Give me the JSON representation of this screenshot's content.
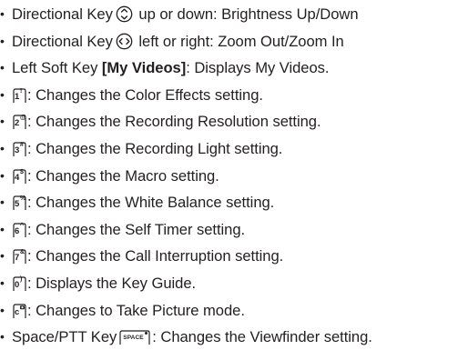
{
  "bullet": "•",
  "items": [
    {
      "pre": "Directional Key",
      "key_type": "dir-ud",
      "key_icon": "up-down-directional-key-icon",
      "post": " up or down: Brightness Up/Down"
    },
    {
      "pre": "Directional Key",
      "key_type": "dir-lr",
      "key_icon": "left-right-directional-key-icon",
      "post": " left or right: Zoom Out/Zoom In"
    },
    {
      "pre": "Left Soft Key ",
      "bold": "[My Videos]",
      "post": ": Displays My Videos."
    },
    {
      "key_num": "1",
      "key_sym": "!",
      "key_icon": "key-1-icon",
      "post": ": Changes the Color Effects setting."
    },
    {
      "key_num": "2",
      "key_sym": "@",
      "key_icon": "key-2-icon",
      "post": ": Changes the Recording Resolution setting."
    },
    {
      "key_num": "3",
      "key_sym": "#",
      "key_icon": "key-3-icon",
      "post": ": Changes the Recording Light setting."
    },
    {
      "key_num": "4",
      "key_sym": "$",
      "key_icon": "key-4-icon",
      "post": ": Changes the Macro setting."
    },
    {
      "key_num": "5",
      "key_sym": "%",
      "key_icon": "key-5-icon",
      "post": ": Changes the White Balance setting."
    },
    {
      "key_num": "6",
      "key_sym": "^",
      "key_icon": "key-6-icon",
      "post": ": Changes the Self Timer setting."
    },
    {
      "key_num": "7",
      "key_sym": "&",
      "key_icon": "key-7-icon",
      "post": ": Changes the Call Interruption setting."
    },
    {
      "key_num": "0",
      "key_sym": ")",
      "key_icon": "key-0-icon",
      "post": ": Displays the Key Guide."
    },
    {
      "key_num": "c",
      "key_sym": "camera",
      "key_icon": "camera-key-icon",
      "post": ": Changes to Take Picture mode."
    },
    {
      "pre": "Space/PTT Key",
      "space_label": "SPACE",
      "key_icon": "space-ptt-key-icon",
      "post": ": Changes the Viewfinder setting."
    }
  ]
}
